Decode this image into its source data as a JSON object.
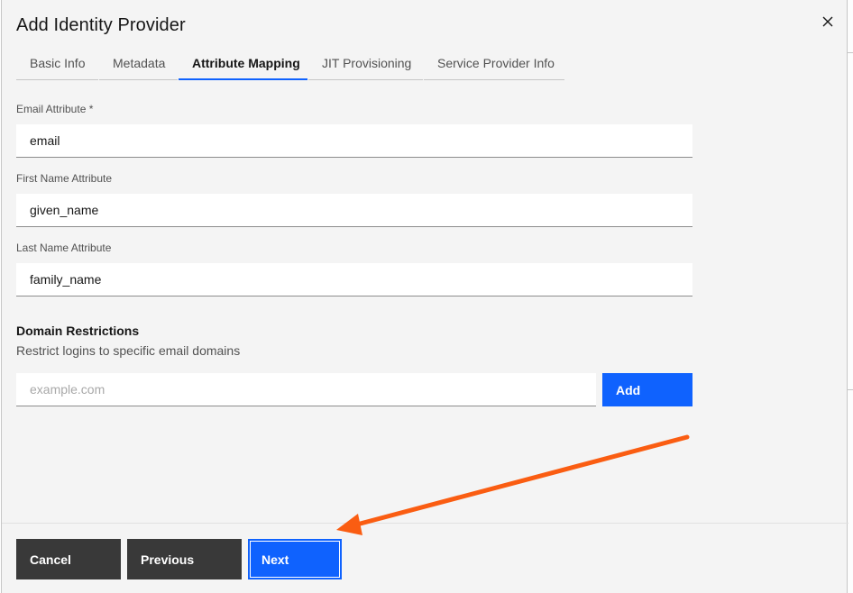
{
  "modal": {
    "title": "Add Identity Provider",
    "close_icon": "close-icon"
  },
  "tabs": [
    {
      "label": "Basic Info",
      "active": false
    },
    {
      "label": "Metadata",
      "active": false
    },
    {
      "label": "Attribute Mapping",
      "active": true
    },
    {
      "label": "JIT Provisioning",
      "active": false
    },
    {
      "label": "Service Provider Info",
      "active": false
    }
  ],
  "fields": {
    "email": {
      "label": "Email Attribute *",
      "value": "email"
    },
    "first_name": {
      "label": "First Name Attribute",
      "value": "given_name"
    },
    "last_name": {
      "label": "Last Name Attribute",
      "value": "family_name"
    }
  },
  "domain_restrictions": {
    "heading": "Domain Restrictions",
    "description": "Restrict logins to specific email domains",
    "placeholder": "example.com",
    "add_label": "Add"
  },
  "footer": {
    "cancel_label": "Cancel",
    "previous_label": "Previous",
    "next_label": "Next"
  },
  "annotation": {
    "arrow_color": "#fa5d12",
    "arrow_icon": "arrow-pointer-icon"
  },
  "colors": {
    "primary": "#0f62fe",
    "secondary_button": "#393939",
    "modal_background": "#f4f4f4"
  }
}
